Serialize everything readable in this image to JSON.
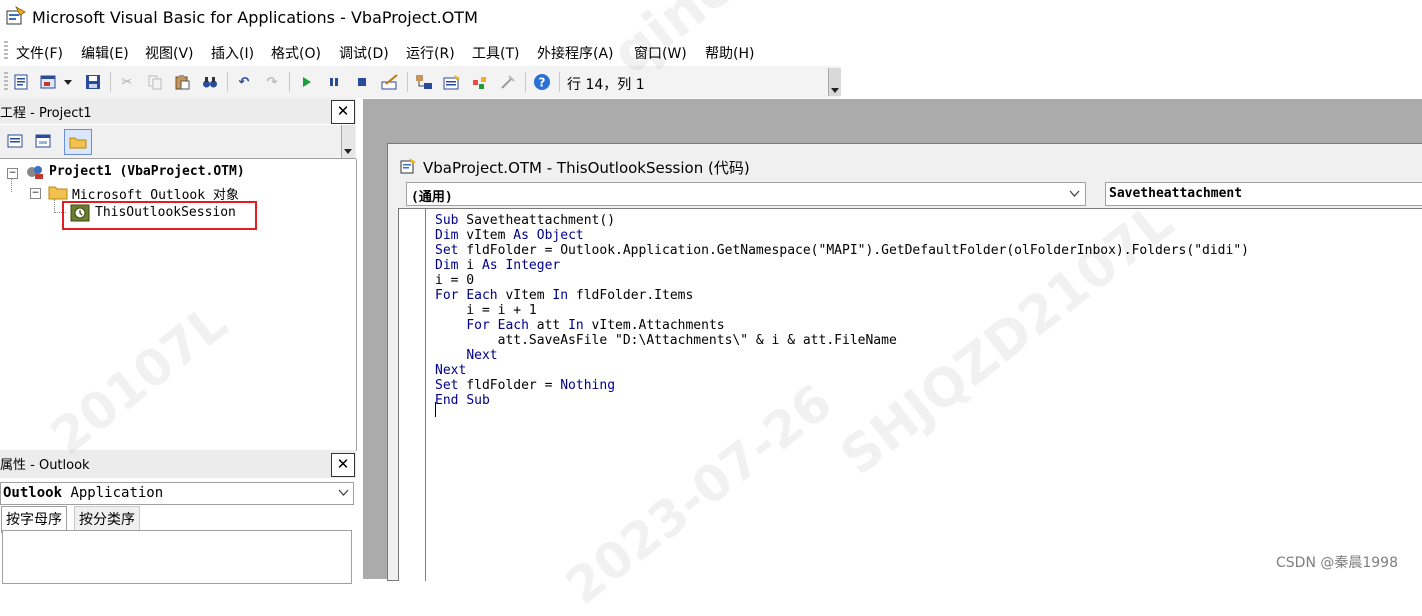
{
  "window": {
    "title": "Microsoft Visual Basic for Applications - VbaProject.OTM",
    "app_icon": "vba-app-icon"
  },
  "menu": {
    "items": [
      "文件(F)",
      "编辑(E)",
      "视图(V)",
      "插入(I)",
      "格式(O)",
      "调试(D)",
      "运行(R)",
      "工具(T)",
      "外接程序(A)",
      "窗口(W)",
      "帮助(H)"
    ]
  },
  "toolbar": {
    "cursor_position": "行 14，列 1",
    "icons": [
      "view-host-icon",
      "insert-module-icon",
      "save-icon",
      "cut-icon",
      "copy-icon",
      "paste-icon",
      "find-icon",
      "undo-icon",
      "redo-icon",
      "run-icon",
      "break-icon",
      "reset-icon",
      "design-mode-icon",
      "project-explorer-icon",
      "properties-icon",
      "object-browser-icon",
      "toolbox-icon",
      "help-icon"
    ]
  },
  "project_pane": {
    "title": "工程 - Project1",
    "close": "✕",
    "tree": {
      "root": "Project1 (VbaProject.OTM)",
      "folder": "Microsoft Outlook 对象",
      "item": "ThisOutlookSession"
    }
  },
  "properties_pane": {
    "title": "属性 - Outlook",
    "close": "✕",
    "object_bold": "Outlook",
    "object_type": " Application",
    "tabs": [
      "按字母序",
      "按分类序"
    ]
  },
  "code_window": {
    "title": "VbaProject.OTM - ThisOutlookSession (代码)",
    "object_combo": "(通用)",
    "procedure_combo": "Savetheattachment",
    "lines": [
      [
        "kw:Sub",
        " Savetheattachment()"
      ],
      [
        "kw:Dim",
        " vItem ",
        "kw:As",
        " ",
        "kw:Object"
      ],
      [
        "kw:Set",
        " fldFolder = Outlook.Application.GetNamespace(\"MAPI\").GetDefaultFolder(olFolderInbox).Folders(\"didi\")"
      ],
      [
        "kw:Dim",
        " i ",
        "kw:As",
        " ",
        "kw:Integer"
      ],
      [
        "",
        "i = 0"
      ],
      [
        "kw:For",
        " ",
        "kw:Each",
        " vItem ",
        "kw:In",
        " fldFolder.Items"
      ],
      [
        "",
        "    i = i + 1"
      ],
      [
        "",
        "    ",
        "kw:For",
        " ",
        "kw:Each",
        " att ",
        "kw:In",
        " vItem.Attachments"
      ],
      [
        "",
        "        att.SaveAsFile \"D:\\Attachments\\\" & i & att.FileName"
      ],
      [
        "",
        "    ",
        "kw:Next"
      ],
      [
        "kw:Next"
      ],
      [
        "kw:Set",
        " fldFolder = ",
        "kw:Nothing"
      ],
      [
        "kw:End",
        " ",
        "kw:Sub"
      ],
      [
        ""
      ]
    ]
  },
  "watermark": {
    "csdn": "CSDN @秦晨1998",
    "faint": [
      "qinc",
      "20107L",
      "SHJQZD2107L",
      "2023-07-26"
    ]
  },
  "colors": {
    "keyword": "#00008b",
    "mdi_background": "#ababab",
    "highlight_box": "#e02020"
  }
}
